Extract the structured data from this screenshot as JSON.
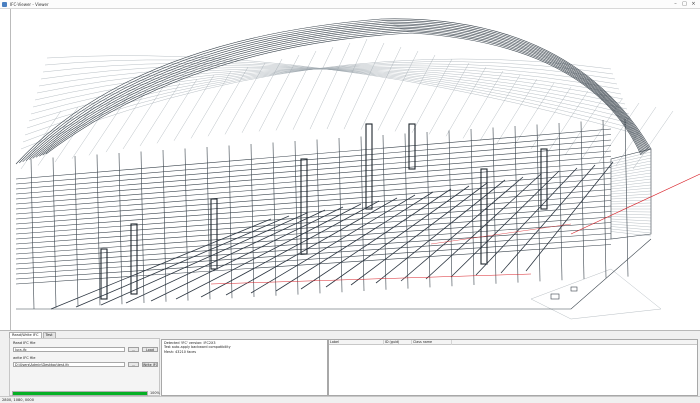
{
  "window": {
    "title": "IFC-Viewer - Viewer",
    "min_glyph": "–",
    "max_glyph": "□",
    "close_glyph": "×"
  },
  "tabs": [
    {
      "label": "Read/Write IFC"
    },
    {
      "label": "Test"
    }
  ],
  "read": {
    "label": "Read IFC file",
    "file_value": "Jura.ifc",
    "browse_label": "...",
    "load_label": "Load"
  },
  "write": {
    "label": "write IFC file",
    "file_value": "D:\\Users\\Admin\\Desktop\\test.ifc",
    "browse_label": "...",
    "write_label": "Write IFC"
  },
  "progress": {
    "value": 100,
    "text": "100%"
  },
  "log": {
    "lines": [
      "Detected 'IFC' version: IFC2X3",
      "Test auto-apply backward compatibility",
      "Mesh: 43210 faces"
    ]
  },
  "table": {
    "headers": [
      "Label",
      "ID (guid)",
      "Class name"
    ],
    "rows": [
      {
        "label": "",
        "id": "",
        "class_name": ""
      }
    ]
  },
  "status": {
    "text": "2800, 1080, 0000"
  },
  "colors": {
    "accent_red": "#d9232a",
    "progress": "#06b025",
    "structure": "#2f3a44"
  }
}
